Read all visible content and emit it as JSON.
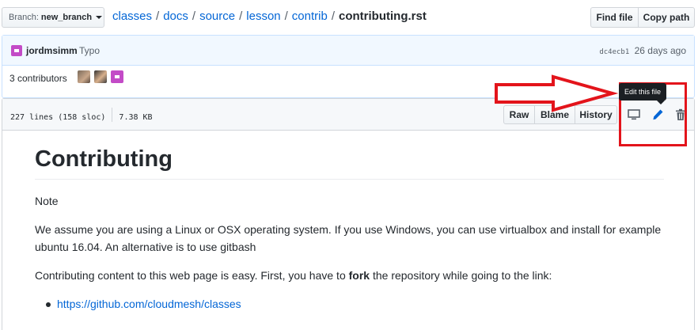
{
  "toolbar": {
    "branch_prefix": "Branch:",
    "branch_name": "new_branch",
    "breadcrumb": [
      "classes",
      "docs",
      "source",
      "lesson",
      "contrib"
    ],
    "separator": "/",
    "file_name": "contributing.rst",
    "find_file_label": "Find file",
    "copy_path_label": "Copy path"
  },
  "commit": {
    "author": "jordmsimm",
    "message": "Typo",
    "sha": "dc4ecb1",
    "time": "26 days ago"
  },
  "contributors": {
    "text": "3 contributors"
  },
  "file_header": {
    "lines": "227 lines (158 sloc)",
    "size": "7.38 KB",
    "raw_label": "Raw",
    "blame_label": "Blame",
    "history_label": "History",
    "edit_tooltip": "Edit this file"
  },
  "readme": {
    "title": "Contributing",
    "note": "Note",
    "para1": "We assume you are using a Linux or OSX operating system. If you use Windows, you can use virtualbox and install for example ubuntu 16.04. An alternative is to use gitbash",
    "para2_before": "Contributing content to this web page is easy. First, you have to ",
    "para2_bold": "fork",
    "para2_after": " the repository while going to the link:",
    "link": "https://github.com/cloudmesh/classes"
  },
  "colors": {
    "link": "#0366d6",
    "annotation": "#e3141b",
    "commit_bg": "#f1f8ff"
  },
  "icons": [
    "caret-down-icon",
    "desktop-icon",
    "pencil-icon",
    "trash-icon",
    "red-arrow-annotation"
  ]
}
